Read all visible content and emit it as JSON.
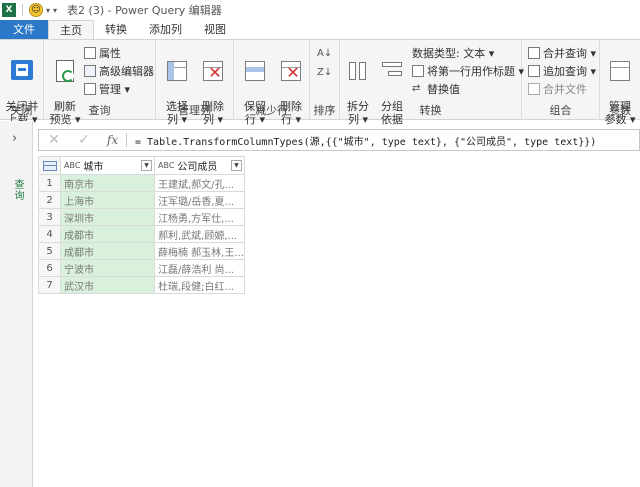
{
  "window": {
    "title": "表2 (3) - Power Query 编辑器",
    "excel_icon": "X",
    "qat_icon": "☺"
  },
  "tabs": [
    {
      "label": "文件"
    },
    {
      "label": "主页"
    },
    {
      "label": "转换"
    },
    {
      "label": "添加列"
    },
    {
      "label": "视图"
    }
  ],
  "ribbon": {
    "close_group": {
      "label": "关闭",
      "close_load": "关闭并\n上载 ▾"
    },
    "query_group": {
      "label": "查询",
      "refresh": "刷新\n预览 ▾",
      "properties": "属性",
      "advanced_editor": "高级编辑器",
      "manage": "管理 ▾"
    },
    "manage_cols_group": {
      "label": "管理列",
      "choose_cols": "选择\n列 ▾",
      "remove_cols": "删除\n列 ▾"
    },
    "reduce_rows_group": {
      "label": "减少行",
      "keep_rows": "保留\n行 ▾",
      "remove_rows": "删除\n行 ▾"
    },
    "sort_group": {
      "label": "排序"
    },
    "transform_group": {
      "label": "转换",
      "split_col": "拆分\n列 ▾",
      "group_by": "分组\n依据",
      "data_type": "数据类型: 文本 ▾",
      "first_row_header": "将第一行用作标题 ▾",
      "replace_values": "替换值"
    },
    "combine_group": {
      "label": "组合",
      "merge_queries": "合并查询 ▾",
      "append_queries": "追加查询 ▾",
      "combine_files": "合并文件"
    },
    "params_group": {
      "label": "参数",
      "manage_params": "管理\n参数 ▾"
    }
  },
  "left_pane": {
    "label": "查询"
  },
  "formula_bar": {
    "cancel": "✕",
    "confirm": "✓",
    "fx": "fx",
    "formula": "= Table.TransformColumnTypes(源,{{\"城市\", type text}, {\"公司成员\", type text}})"
  },
  "grid": {
    "type_icon": "ABC",
    "columns": [
      "城市",
      "公司成员"
    ],
    "rows": [
      {
        "n": "1",
        "city": "南京市",
        "members": "王建斌,郝文/孔..."
      },
      {
        "n": "2",
        "city": "上海市",
        "members": "汪军璐/岳香,夏..."
      },
      {
        "n": "3",
        "city": "深圳市",
        "members": "江杨勇,方军仕,..."
      },
      {
        "n": "4",
        "city": "成都市",
        "members": "郝利,武斌,顾嫄,..."
      },
      {
        "n": "5",
        "city": "成都市",
        "members": "薛梅楠 郝玉林,王..."
      },
      {
        "n": "6",
        "city": "宁波市",
        "members": "江磊/薛浩利 尚..."
      },
      {
        "n": "7",
        "city": "武汉市",
        "members": "杜瑞,段健;白红..."
      }
    ]
  },
  "colors": {
    "file_tab": "#2b78c8",
    "city_column_bg": "#d9f0dc",
    "excel_green": "#1e7145"
  }
}
